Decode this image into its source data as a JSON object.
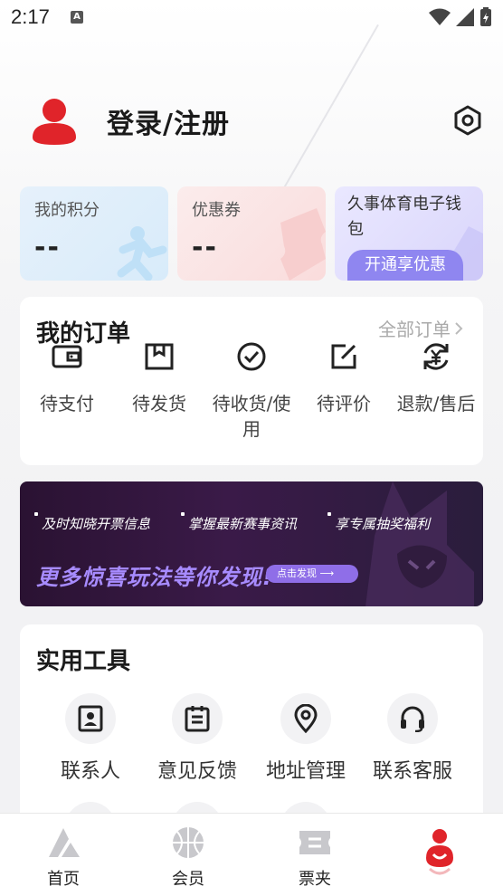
{
  "status_bar": {
    "time": "2:17",
    "notification_icon": "A"
  },
  "profile": {
    "login_label": "登录/注册",
    "avatar_icon": "user-avatar-icon",
    "settings_icon": "settings-hexagon-icon"
  },
  "cards": {
    "points": {
      "label": "我的积分",
      "value": "--"
    },
    "coupons": {
      "label": "优惠券",
      "value": "--"
    },
    "wallet": {
      "label": "久事体育电子钱包",
      "button": "开通享优惠"
    }
  },
  "orders": {
    "title": "我的订单",
    "all_link": "全部订单",
    "items": [
      {
        "label": "待支付",
        "icon": "wallet-icon"
      },
      {
        "label": "待发货",
        "icon": "box-icon"
      },
      {
        "label": "待收货/使用",
        "icon": "check-circle-icon"
      },
      {
        "label": "待评价",
        "icon": "edit-icon"
      },
      {
        "label": "退款/售后",
        "icon": "refund-icon"
      }
    ]
  },
  "banner": {
    "tags": [
      "及时知晓开票信息",
      "掌握最新赛事资讯",
      "享专属抽奖福利"
    ],
    "headline": "更多惊喜玩法等你发现!",
    "cta": "点击发现 ⟶"
  },
  "tools": {
    "title": "实用工具",
    "items": [
      {
        "label": "联系人",
        "icon": "contact-icon"
      },
      {
        "label": "意见反馈",
        "icon": "feedback-icon"
      },
      {
        "label": "地址管理",
        "icon": "location-icon"
      },
      {
        "label": "联系客服",
        "icon": "headset-icon"
      }
    ]
  },
  "bottom_nav": {
    "items": [
      {
        "label": "首页",
        "icon": "home-logo-icon"
      },
      {
        "label": "会员",
        "icon": "basketball-icon"
      },
      {
        "label": "票夹",
        "icon": "ticket-icon"
      },
      {
        "label": "",
        "icon": "profile-active-icon"
      }
    ],
    "accent_color": "#e0242a"
  }
}
